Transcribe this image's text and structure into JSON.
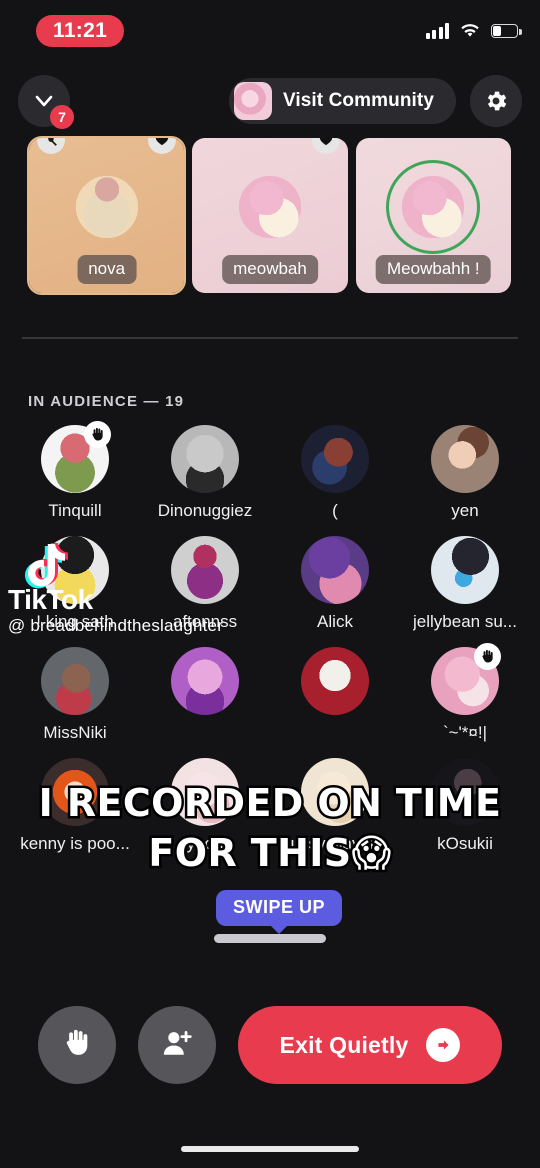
{
  "status_bar": {
    "time": "11:21",
    "signal_icon": "signal-bars-icon",
    "wifi_icon": "wifi-icon",
    "battery_icon": "battery-low-icon",
    "battery_level": "30%",
    "time_pill_color": "#E93B4E"
  },
  "header": {
    "collapse_icon": "chevron-down-icon",
    "notification_count": "7",
    "community_label": "Visit Community",
    "community_avatar": "community-avatar-icon",
    "settings_icon": "gear-icon"
  },
  "stage": {
    "cards": [
      {
        "name": "nova",
        "avatar": "nova-avatar",
        "badge_left": "muted-mic-icon",
        "badge_right": "heart-icon",
        "speaking": false,
        "selected": true
      },
      {
        "name": "meowbah",
        "avatar": "meowbah-avatar",
        "badge_right": "heart-icon",
        "speaking": false,
        "selected": false
      },
      {
        "name": "Meowbahh !",
        "avatar": "meowbahh-avatar",
        "speaking": true,
        "selected": false
      }
    ]
  },
  "audience": {
    "section_label": "IN AUDIENCE — 19",
    "count": "19",
    "members": [
      {
        "name": "Tinquill",
        "avatar_class": "a-tinquill",
        "hand_raised": true
      },
      {
        "name": "Dinonuggiez",
        "avatar_class": "a-dino",
        "hand_raised": false
      },
      {
        "name": "(",
        "avatar_class": "a-paren",
        "hand_raised": false
      },
      {
        "name": "yen",
        "avatar_class": "a-yen",
        "hand_raised": false
      },
      {
        "name": "! king sath",
        "avatar_class": "a-sath",
        "hand_raised": false
      },
      {
        "name": "aftonnss",
        "avatar_class": "a-afton",
        "hand_raised": false
      },
      {
        "name": "Alick",
        "avatar_class": "a-alick",
        "hand_raised": false
      },
      {
        "name": "jellybean su...",
        "avatar_class": "a-jelly",
        "hand_raised": false
      },
      {
        "name": "MissNiki",
        "avatar_class": "a-missn",
        "hand_raised": false
      },
      {
        "name": "",
        "avatar_class": "a-purple",
        "hand_raised": false
      },
      {
        "name": "",
        "avatar_class": "a-cuphead",
        "hand_raised": false
      },
      {
        "name": "`~'*¤!|",
        "avatar_class": "a-pink",
        "hand_raised": true
      },
      {
        "name": "kenny is poo...",
        "avatar_class": "a-kenny",
        "hand_raised": false
      },
      {
        "name": "yoori",
        "avatar_class": "a-yoori",
        "hand_raised": false
      },
      {
        "name": "pussy slayer...",
        "avatar_class": "a-slayer",
        "hand_raised": false
      },
      {
        "name": "kOsukii",
        "avatar_class": "a-kosukii",
        "hand_raised": false
      }
    ]
  },
  "overlays": {
    "tiktok_brand": "TikTok",
    "tiktok_handle": "@ breadbehindtheslaughter",
    "tiktok_note_icon": "tiktok-note-icon",
    "caption_line1": "I RECORDED ON TIME",
    "caption_line2": "FOR THIS😱",
    "swipe_up_label": "SWIPE UP",
    "swipe_up_color": "#5B5CE0"
  },
  "bottom_bar": {
    "raise_hand_icon": "raised-hand-icon",
    "invite_icon": "add-person-icon",
    "exit_label": "Exit Quietly",
    "exit_icon": "exit-arrow-icon",
    "exit_color": "#E93B4E"
  }
}
